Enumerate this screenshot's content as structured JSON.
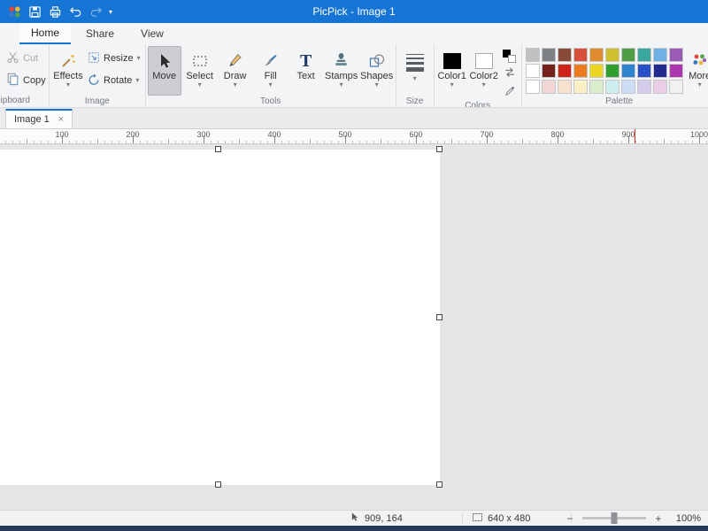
{
  "titlebar": {
    "title": "PicPick - Image 1"
  },
  "icons": {
    "chevron_down": "▾",
    "close": "×"
  },
  "ribbon_tabs": {
    "home": "Home",
    "share": "Share",
    "view": "View"
  },
  "ribbon": {
    "clipboard": {
      "label": "Clipboard",
      "cut": "Cut",
      "copy": "Copy"
    },
    "image": {
      "label": "Image",
      "effects": "Effects",
      "resize": "Resize",
      "rotate": "Rotate"
    },
    "tools": {
      "label": "Tools",
      "move": "Move",
      "select": "Select",
      "draw": "Draw",
      "fill": "Fill",
      "text": "Text",
      "stamps": "Stamps",
      "shapes": "Shapes"
    },
    "size": {
      "label": "Size"
    },
    "colors": {
      "label": "Colors",
      "color1_label": "Color1",
      "color2_label": "Color2",
      "color1": "#000000",
      "color2": "#ffffff"
    },
    "palette": {
      "label": "Palette",
      "more": "More",
      "rows": [
        [
          "#bfc1c3",
          "#7f8284",
          "#8a4a3a",
          "#d8503c",
          "#e08a2e",
          "#cfc02f",
          "#4f9e45",
          "#3aa6a0",
          "#6fb1e4",
          "#9a5bb5"
        ],
        [
          "#ffffff",
          "#76201c",
          "#d02318",
          "#e87c1e",
          "#ead51f",
          "#2f9e2f",
          "#2f84d0",
          "#2b50c8",
          "#232a8f",
          "#ad35ad"
        ],
        [
          "#ffffff",
          "#f2d6d3",
          "#f7e3cd",
          "#f9f0c4",
          "#d9efcb",
          "#cdeeee",
          "#cdddf5",
          "#d6cdee",
          "#eccde6",
          "#f1f1f1"
        ]
      ]
    }
  },
  "doc_tabs": {
    "image1": "Image 1"
  },
  "ruler": {
    "labels": [
      "100",
      "200",
      "300",
      "400",
      "500",
      "600",
      "700",
      "800",
      "900",
      "1000"
    ],
    "marker_value": 909
  },
  "statusbar": {
    "cursor_pos": "909, 164",
    "canvas_size": "640 x 480",
    "zoom_out": "−",
    "zoom_in": "+",
    "zoom_level": "100%"
  },
  "colors": {
    "titlebar_bg": "#1574d4",
    "accent": "#1574d4",
    "ruler_marker": "#d93025",
    "workspace_bg": "#e4e5e7",
    "canvas_bg": "#ffffff",
    "taskbar_strip": "#24395c"
  }
}
